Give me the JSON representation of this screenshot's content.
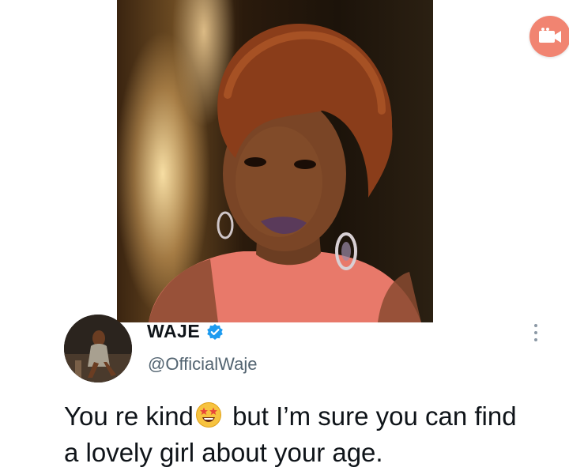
{
  "tweet": {
    "display_name": "WAJE",
    "handle": "@OfficialWaje",
    "text_before_emoji": "You re kind",
    "emoji": "star-struck",
    "text_after_emoji": " but I’m sure you can find a lovely girl about your age."
  },
  "icons": {
    "record": "video-record-icon",
    "verified": "verified-badge-icon",
    "more": "more-vertical-icon"
  },
  "colors": {
    "record_button": "#f18471",
    "verified": "#1d9bf0",
    "handle": "#536471",
    "text": "#0f1419"
  }
}
